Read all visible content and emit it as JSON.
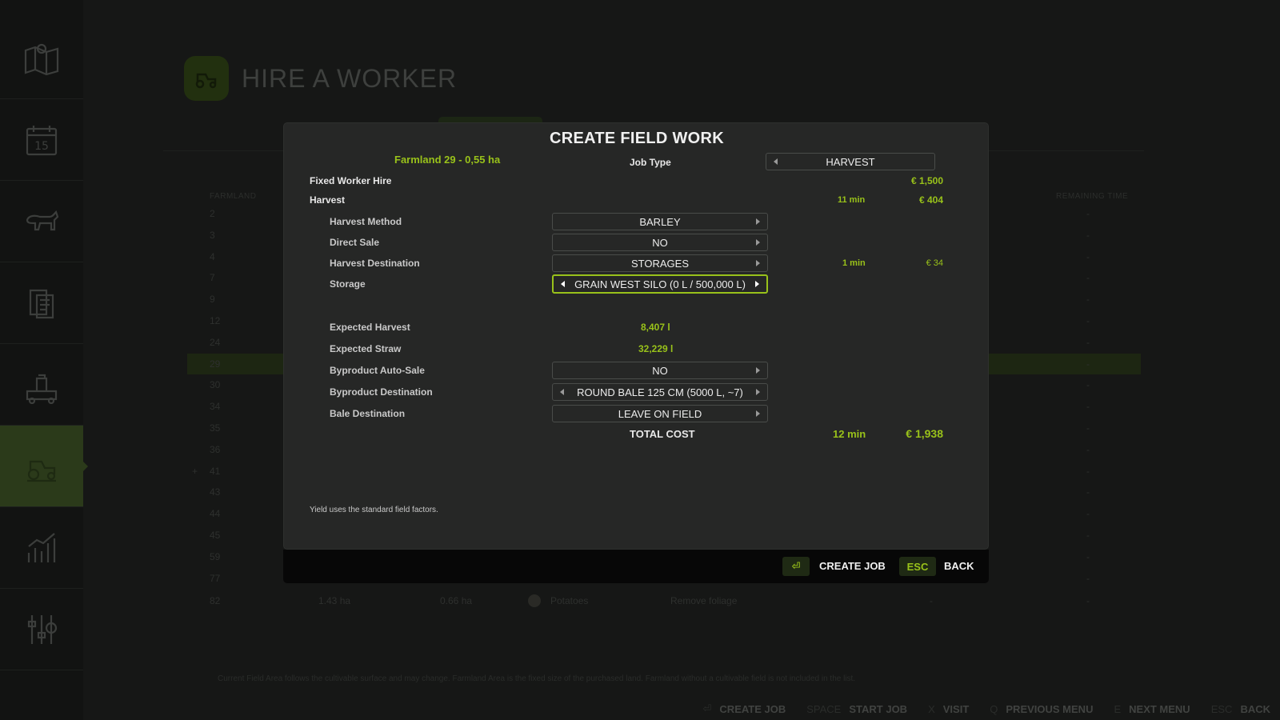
{
  "page": {
    "title": "HIRE A WORKER"
  },
  "background": {
    "columns": {
      "farmland": "FARMLAND",
      "remaining_time": "REMAINING TIME"
    },
    "rows": [
      "2",
      "3",
      "4",
      "7",
      "9",
      "12",
      "24",
      "29",
      "30",
      "34",
      "35",
      "36",
      "41",
      "43",
      "44",
      "45",
      "59",
      "77"
    ],
    "highlighted_row": "29",
    "expand_marker": "+",
    "dash": "-",
    "last_row": {
      "farmland": "82",
      "area": "1.43 ha",
      "field_area": "0.66 ha",
      "crop": "Potatoes",
      "status": "Remove foliage",
      "time": "-",
      "remaining": "-"
    },
    "footnote": "Current Field Area follows the cultivable surface and may change. Farmland Area is the fixed size of the purchased land. Farmland without a cultivable field is not included in the list.",
    "bottom_bar": [
      {
        "key": "⏎",
        "label": "CREATE JOB"
      },
      {
        "key": "SPACE",
        "label": "START JOB"
      },
      {
        "key": "X",
        "label": "VISIT"
      },
      {
        "key": "Q",
        "label": "PREVIOUS MENU"
      },
      {
        "key": "E",
        "label": "NEXT MENU"
      },
      {
        "key": "ESC",
        "label": "BACK"
      }
    ]
  },
  "modal": {
    "title": "CREATE FIELD WORK",
    "farmland": "Farmland 29 - 0,55 ha",
    "job_type_label": "Job Type",
    "job_type_value": "HARVEST",
    "fixed_worker_hire_label": "Fixed Worker Hire",
    "fixed_worker_hire_cost": "€ 1,500",
    "harvest_label": "Harvest",
    "harvest_time": "11 min",
    "harvest_cost": "€ 404",
    "harvest_method_label": "Harvest Method",
    "harvest_method_value": "BARLEY",
    "direct_sale_label": "Direct Sale",
    "direct_sale_value": "NO",
    "harvest_destination_label": "Harvest Destination",
    "harvest_destination_value": "STORAGES",
    "harvest_destination_time": "1 min",
    "harvest_destination_cost": "€ 34",
    "storage_label": "Storage",
    "storage_value": "GRAIN WEST SILO (0 L / 500,000 L)",
    "expected_harvest_label": "Expected Harvest",
    "expected_harvest_value": "8,407 l",
    "expected_straw_label": "Expected Straw",
    "expected_straw_value": "32,229 l",
    "byproduct_auto_sale_label": "Byproduct Auto-Sale",
    "byproduct_auto_sale_value": "NO",
    "byproduct_destination_label": "Byproduct Destination",
    "byproduct_destination_value": "ROUND BALE 125 CM (5000 L, ~7)",
    "bale_destination_label": "Bale Destination",
    "bale_destination_value": "LEAVE ON FIELD",
    "total_cost_label": "TOTAL COST",
    "total_time": "12 min",
    "total_cost": "€ 1,938",
    "note": "Yield uses the standard field factors."
  },
  "footer": {
    "create_job_key": "⏎",
    "create_job_label": "CREATE JOB",
    "back_key": "ESC",
    "back_label": "BACK"
  },
  "colors": {
    "accent": "#99c21a",
    "active_sidebar": "#2b3a1a",
    "modal_bg": "#262726"
  },
  "sidebar_icons": [
    "map-icon",
    "calendar-icon",
    "animals-icon",
    "contracts-icon",
    "production-icon",
    "tractor-icon",
    "statistics-icon",
    "settings-icon"
  ]
}
